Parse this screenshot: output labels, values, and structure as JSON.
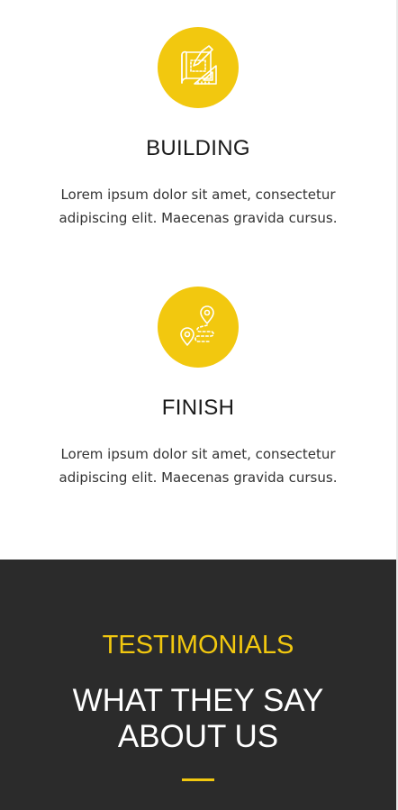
{
  "features": [
    {
      "icon": "blueprint-icon",
      "title": "BUILDING",
      "description": "Lorem ipsum dolor sit amet, consectetur adipiscing elit. Maecenas gravida cursus."
    },
    {
      "icon": "route-pin-icon",
      "title": "FINISH",
      "description": "Lorem ipsum dolor sit amet, consectetur adipiscing elit. Maecenas gravida cursus."
    }
  ],
  "testimonials": {
    "eyebrow": "TESTIMONIALS",
    "heading": "WHAT THEY SAY ABOUT US"
  },
  "colors": {
    "accent": "#f2c80f",
    "dark_bg": "#2b2b2b",
    "text": "#1a1a1a"
  }
}
